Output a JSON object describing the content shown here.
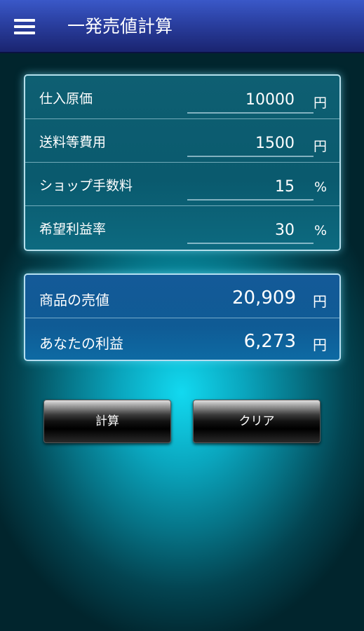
{
  "app_bar": {
    "title": "一発売値計算",
    "menu_icon": "hamburger-menu-icon"
  },
  "inputs": [
    {
      "label": "仕入原価",
      "value": "10000",
      "unit": "円"
    },
    {
      "label": "送料等費用",
      "value": "1500",
      "unit": "円"
    },
    {
      "label": "ショップ手数料",
      "value": "15",
      "unit": "%"
    },
    {
      "label": "希望利益率",
      "value": "30",
      "unit": "%"
    }
  ],
  "results": [
    {
      "label": "商品の売値",
      "value": "20,909",
      "unit": "円"
    },
    {
      "label": "あなたの利益",
      "value": "6,273",
      "unit": "円"
    }
  ],
  "buttons": {
    "calculate": "計算",
    "clear": "クリア"
  },
  "colors": {
    "app_bar": "#2a3fa0",
    "background_glow": "#12d9f0",
    "result_panel": "#0f5b95"
  }
}
